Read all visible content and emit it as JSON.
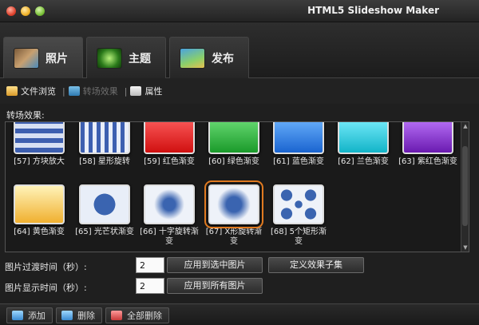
{
  "window": {
    "title": "HTML5 Slideshow Maker"
  },
  "tabs": [
    {
      "label": "照片",
      "icon": "photos-icon"
    },
    {
      "label": "主题",
      "icon": "theme-icon"
    },
    {
      "label": "发布",
      "icon": "publish-icon"
    }
  ],
  "toolbar": {
    "browse_label": "文件浏览",
    "transition_label": "转场效果",
    "properties_label": "属性",
    "separator": "|"
  },
  "transitions": {
    "section_label": "转场效果:",
    "items": [
      {
        "label": "[57] 方块放大"
      },
      {
        "label": "[58] 星形旋转"
      },
      {
        "label": "[59] 红色渐变"
      },
      {
        "label": "[60] 绿色渐变"
      },
      {
        "label": "[61] 蓝色渐变"
      },
      {
        "label": "[62] 兰色渐变"
      },
      {
        "label": "[63] 紫红色渐变"
      },
      {
        "label": "[64] 黄色渐变"
      },
      {
        "label": "[65] 光芒状渐变"
      },
      {
        "label": "[66] 十字旋转渐变"
      },
      {
        "label": "[67] X形旋转渐变"
      },
      {
        "label": "[68] 5个矩形渐变"
      }
    ],
    "selected": "[67] X形旋转渐变"
  },
  "settings": {
    "transition_time_label": "图片过渡时间（秒）:",
    "transition_time_value": "2",
    "apply_selected_label": "应用到选中图片",
    "define_subset_label": "定义效果子集",
    "display_time_label": "图片显示时间（秒）:",
    "display_time_value": "2",
    "apply_all_label": "应用到所有图片"
  },
  "bottom": {
    "add_label": "添加",
    "delete_label": "删除",
    "delete_all_label": "全部删除"
  },
  "colors": {
    "selection": "#e07a20",
    "background": "#1f1f1f"
  }
}
